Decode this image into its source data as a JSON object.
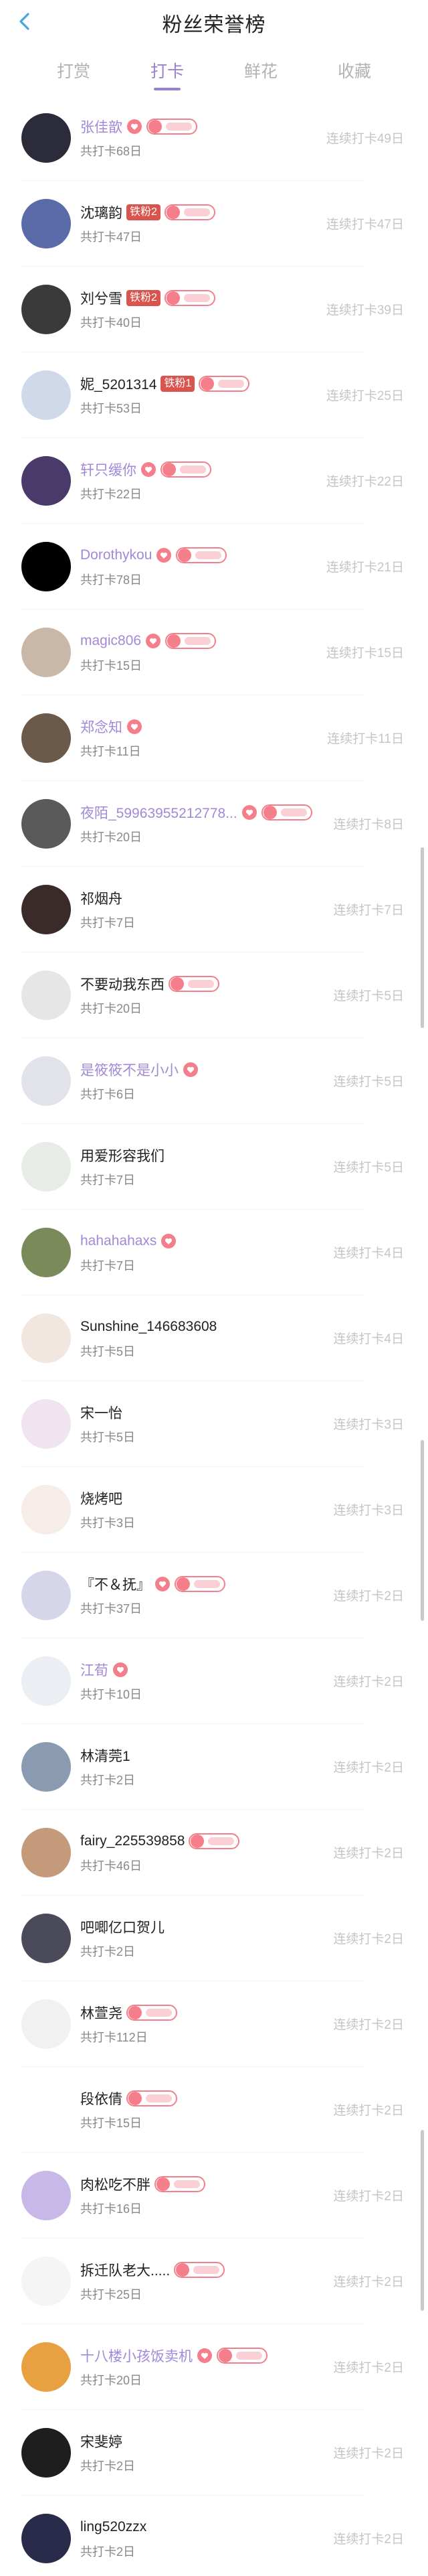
{
  "header": {
    "title": "粉丝荣誉榜"
  },
  "tabs": [
    {
      "label": "打赏"
    },
    {
      "label": "打卡"
    },
    {
      "label": "鲜花"
    },
    {
      "label": "收藏"
    }
  ],
  "active_tab": "打卡",
  "colors": {
    "accent": "#9a7fd6",
    "vip_name": "#a289d8",
    "badge_pink": "#f47f8a",
    "iron_badge": "#d9534f"
  },
  "fans": [
    {
      "name": "张佳歆",
      "total": "共打卡68日",
      "streak": "连续打卡49日",
      "vip": true,
      "heart": true,
      "iron": "",
      "level": true
    },
    {
      "name": "沈璃韵",
      "total": "共打卡47日",
      "streak": "连续打卡47日",
      "vip": false,
      "heart": false,
      "iron": "铁粉2",
      "level": true
    },
    {
      "name": "刘兮雪",
      "total": "共打卡40日",
      "streak": "连续打卡39日",
      "vip": false,
      "heart": false,
      "iron": "铁粉2",
      "level": true
    },
    {
      "name": "妮_5201314",
      "total": "共打卡53日",
      "streak": "连续打卡25日",
      "vip": false,
      "heart": false,
      "iron": "铁粉1",
      "level": true
    },
    {
      "name": "轩只缓你",
      "total": "共打卡22日",
      "streak": "连续打卡22日",
      "vip": true,
      "heart": true,
      "iron": "",
      "level": true
    },
    {
      "name": "Dorothykou",
      "total": "共打卡78日",
      "streak": "连续打卡21日",
      "vip": true,
      "heart": true,
      "iron": "",
      "level": true
    },
    {
      "name": "magic806",
      "total": "共打卡15日",
      "streak": "连续打卡15日",
      "vip": true,
      "heart": true,
      "iron": "",
      "level": true
    },
    {
      "name": "郑念知",
      "total": "共打卡11日",
      "streak": "连续打卡11日",
      "vip": true,
      "heart": true,
      "iron": "",
      "level": false
    },
    {
      "name": "夜陌_59963955212778...",
      "total": "共打卡20日",
      "streak": "连续打卡8日",
      "vip": true,
      "heart": true,
      "iron": "",
      "level": true
    },
    {
      "name": "祁烟舟",
      "total": "共打卡7日",
      "streak": "连续打卡7日",
      "vip": false,
      "heart": false,
      "iron": "",
      "level": false
    },
    {
      "name": "不要动我东西",
      "total": "共打卡20日",
      "streak": "连续打卡5日",
      "vip": false,
      "heart": false,
      "iron": "",
      "level": true
    },
    {
      "name": "是筱筱不是小小",
      "total": "共打卡6日",
      "streak": "连续打卡5日",
      "vip": true,
      "heart": true,
      "iron": "",
      "level": false
    },
    {
      "name": "用爱形容我们",
      "total": "共打卡7日",
      "streak": "连续打卡5日",
      "vip": false,
      "heart": false,
      "iron": "",
      "level": false
    },
    {
      "name": "hahahahaxs",
      "total": "共打卡7日",
      "streak": "连续打卡4日",
      "vip": true,
      "heart": true,
      "iron": "",
      "level": false
    },
    {
      "name": "Sunshine_146683608",
      "total": "共打卡5日",
      "streak": "连续打卡4日",
      "vip": false,
      "heart": false,
      "iron": "",
      "level": false
    },
    {
      "name": "宋一怡",
      "total": "共打卡5日",
      "streak": "连续打卡3日",
      "vip": false,
      "heart": false,
      "iron": "",
      "level": false
    },
    {
      "name": "烧烤吧",
      "total": "共打卡3日",
      "streak": "连续打卡3日",
      "vip": false,
      "heart": false,
      "iron": "",
      "level": false
    },
    {
      "name": "『不＆抚』",
      "total": "共打卡37日",
      "streak": "连续打卡2日",
      "vip": false,
      "heart": true,
      "iron": "",
      "level": true
    },
    {
      "name": "江荀",
      "total": "共打卡10日",
      "streak": "连续打卡2日",
      "vip": true,
      "heart": true,
      "iron": "",
      "level": false
    },
    {
      "name": "林清莞1",
      "total": "共打卡2日",
      "streak": "连续打卡2日",
      "vip": false,
      "heart": false,
      "iron": "",
      "level": false
    },
    {
      "name": "fairy_225539858",
      "total": "共打卡46日",
      "streak": "连续打卡2日",
      "vip": false,
      "heart": false,
      "iron": "",
      "level": true
    },
    {
      "name": "吧唧亿口贺儿",
      "total": "共打卡2日",
      "streak": "连续打卡2日",
      "vip": false,
      "heart": false,
      "iron": "",
      "level": false
    },
    {
      "name": "林萱尧",
      "total": "共打卡112日",
      "streak": "连续打卡2日",
      "vip": false,
      "heart": false,
      "iron": "",
      "level": true
    },
    {
      "name": "段依倩",
      "total": "共打卡15日",
      "streak": "连续打卡2日",
      "vip": false,
      "heart": false,
      "iron": "",
      "level": true
    },
    {
      "name": "肉松吃不胖",
      "total": "共打卡16日",
      "streak": "连续打卡2日",
      "vip": false,
      "heart": false,
      "iron": "",
      "level": true
    },
    {
      "name": "拆迁队老大.....",
      "total": "共打卡25日",
      "streak": "连续打卡2日",
      "vip": false,
      "heart": false,
      "iron": "",
      "level": true
    },
    {
      "name": "十八楼小孩饭卖机",
      "total": "共打卡20日",
      "streak": "连续打卡2日",
      "vip": true,
      "heart": true,
      "iron": "",
      "level": true
    },
    {
      "name": "宋斐婷",
      "total": "共打卡2日",
      "streak": "连续打卡2日",
      "vip": false,
      "heart": false,
      "iron": "",
      "level": false
    },
    {
      "name": "ling520zzx",
      "total": "共打卡2日",
      "streak": "连续打卡2日",
      "vip": false,
      "heart": false,
      "iron": "",
      "level": false
    }
  ]
}
